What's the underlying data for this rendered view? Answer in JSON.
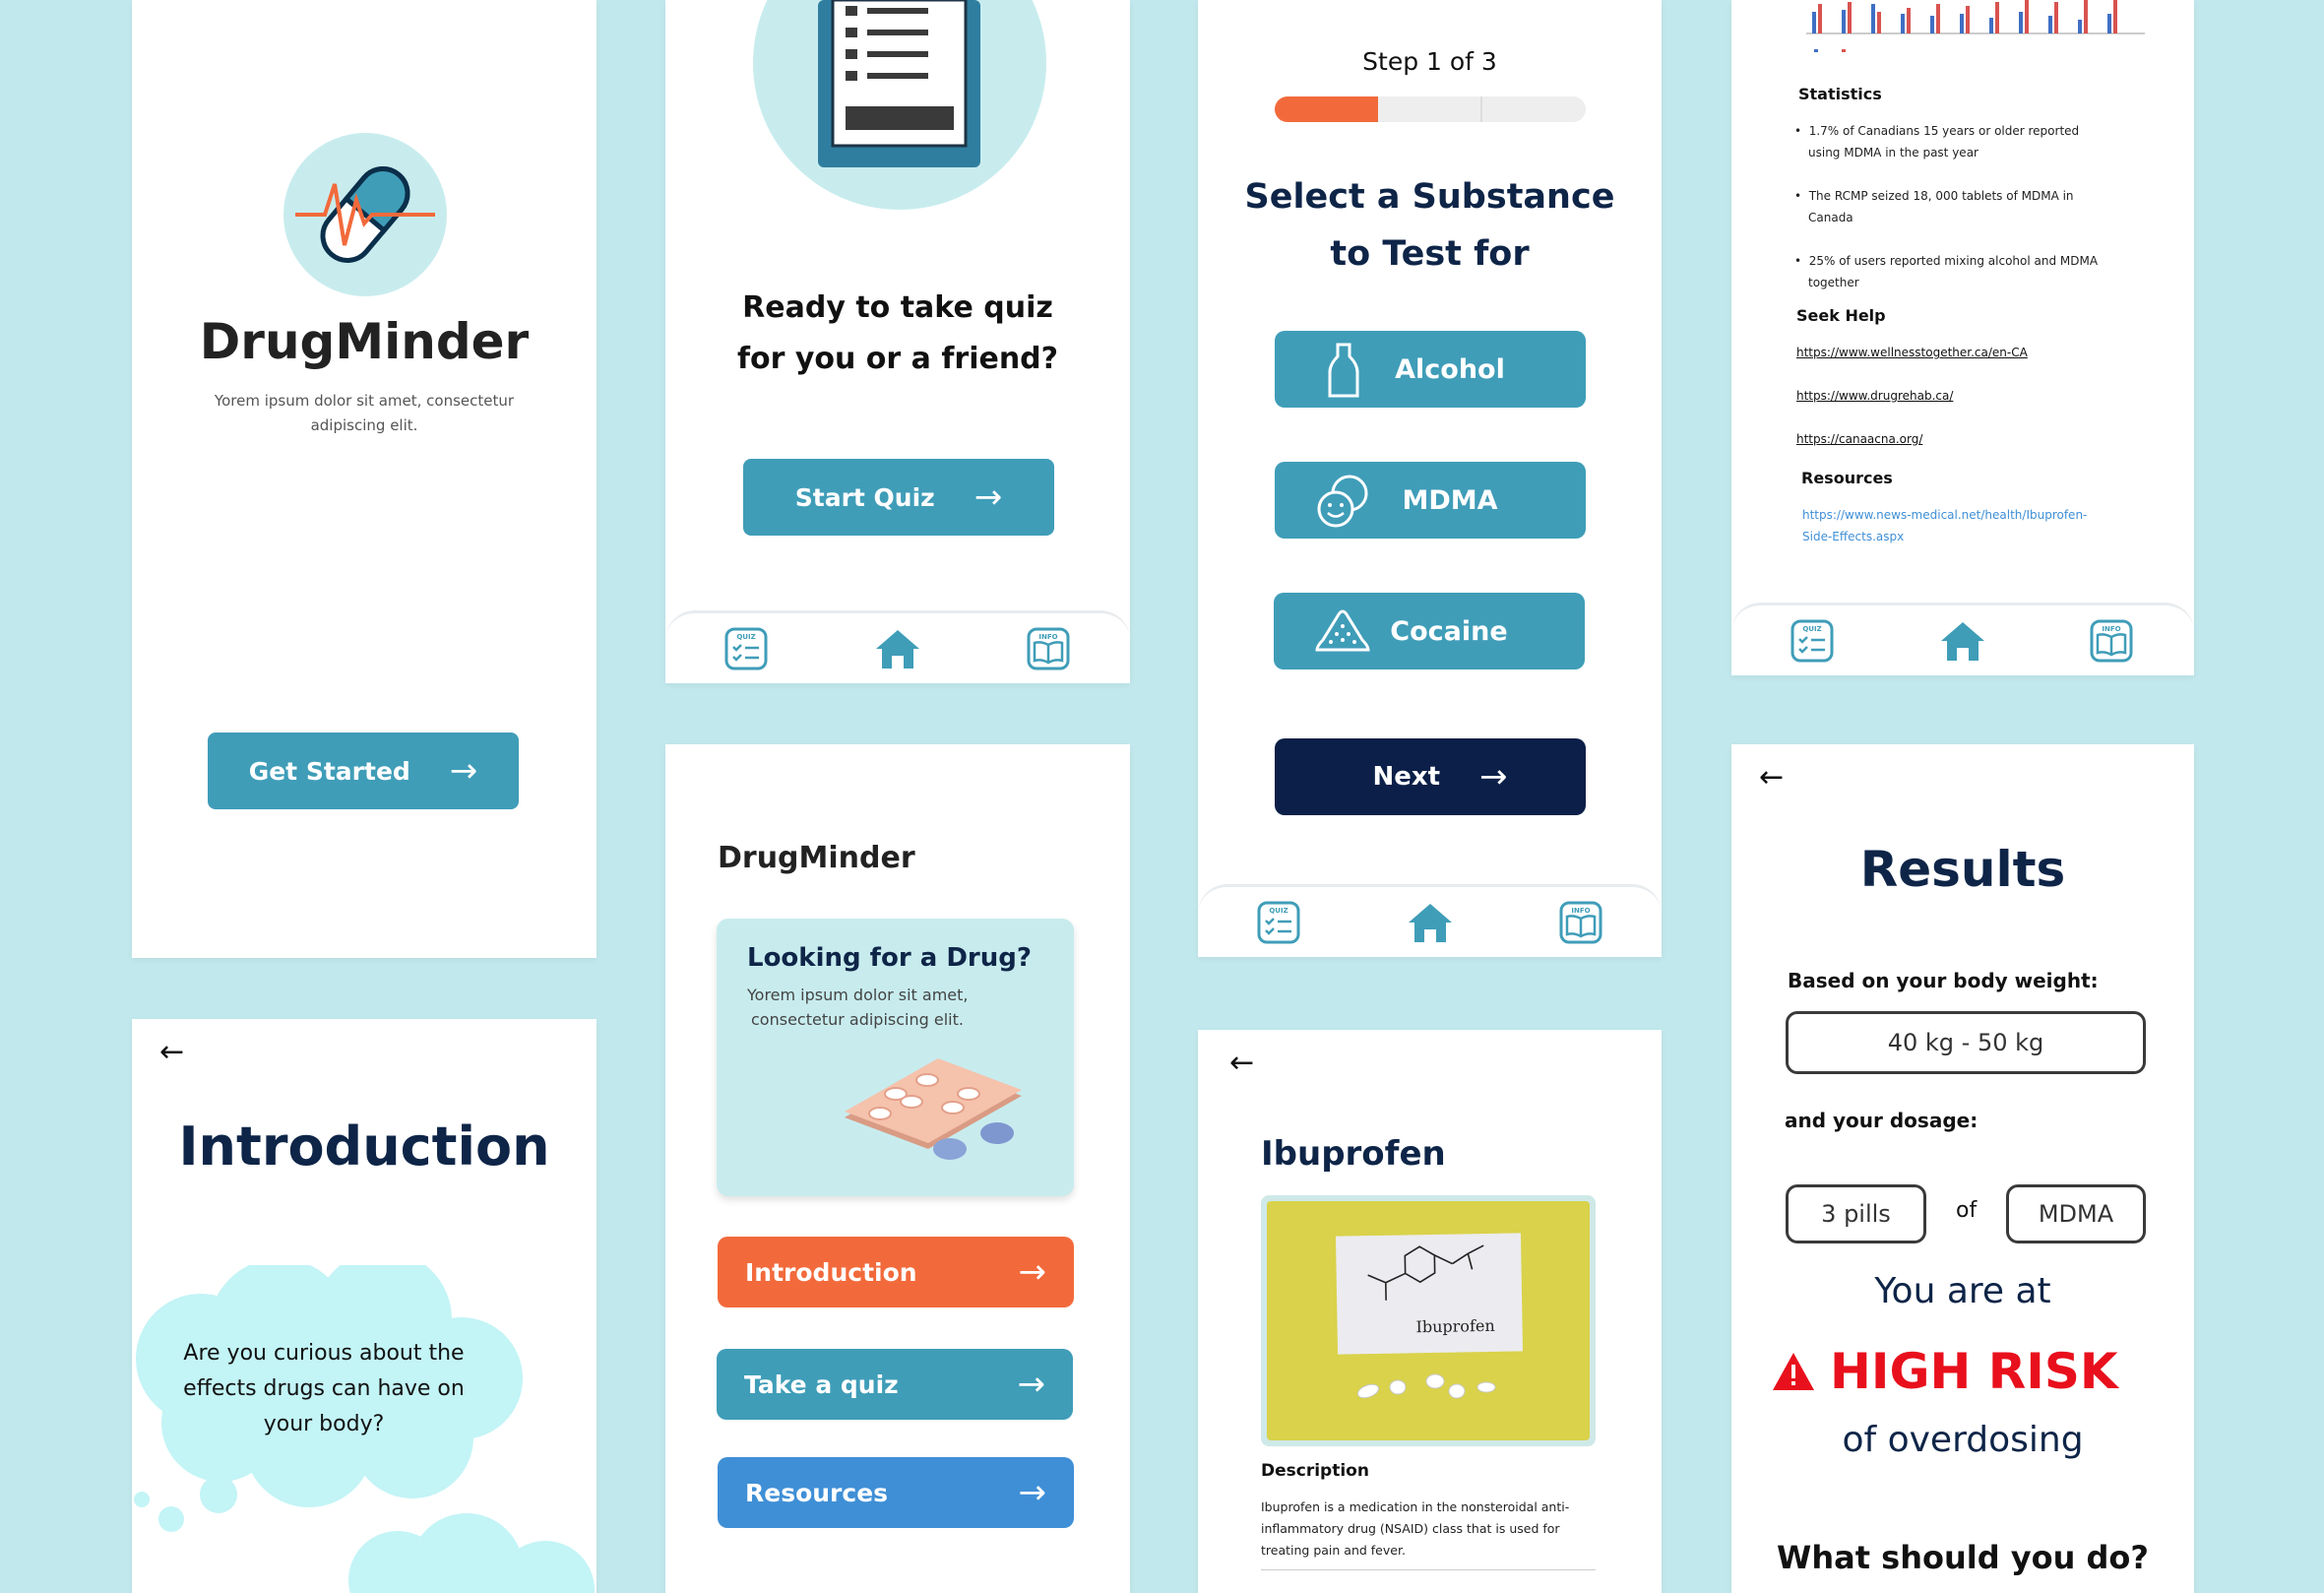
{
  "colors": {
    "background": "#c1e8ec",
    "teal": "#3f9db8",
    "navy": "#0b1f48",
    "orange": "#f26a3b",
    "blue": "#3f8fd6",
    "risk_red": "#e8101c",
    "light_teal": "#c8ecee"
  },
  "welcome": {
    "app_name": "DrugMinder",
    "tagline_line1": "Yorem ipsum dolor sit amet, consectetur",
    "tagline_line2": "adipiscing elit.",
    "get_started": "Get Started"
  },
  "intro": {
    "title": "Introduction",
    "question_line1": "Are you curious about the",
    "question_line2": "effects drugs can have on",
    "question_line3": "your body?"
  },
  "quiz_start": {
    "prompt_line1": "Ready to take quiz",
    "prompt_line2": "for you or a  friend?",
    "start_button": "Start Quiz"
  },
  "tabbar": {
    "quiz_icon_text": "QUIZ",
    "info_icon_text": "INFO"
  },
  "home": {
    "app_name": "DrugMinder",
    "card_title": "Looking for a Drug?",
    "card_text_line1": "Yorem ipsum dolor sit amet,",
    "card_text_line2": "consectetur adipiscing elit.",
    "menu": [
      "Introduction",
      "Take a quiz",
      "Resources"
    ]
  },
  "select": {
    "step": "Step 1 of 3",
    "title_line1": "Select a Substance",
    "title_line2": "to Test for",
    "options": [
      "Alcohol",
      "MDMA",
      "Cocaine"
    ],
    "next": "Next",
    "progress": 0.333
  },
  "drug": {
    "title": "Ibuprofen",
    "image_label": "Ibuprofen",
    "description_heading": "Description",
    "description_line1": "Ibuprofen is a medication in the nonsteroidal anti-",
    "description_line2": "inflammatory drug (NSAID) class that is used for",
    "description_line3": "treating pain and fever."
  },
  "info": {
    "statistics_heading": "Statistics",
    "stats": [
      {
        "line1": "1.7% of Canadians 15 years or older reported",
        "line2": "using MDMA in the past year"
      },
      {
        "line1": "The RCMP seized 18, 000 tablets of MDMA in",
        "line2": "Canada"
      },
      {
        "line1": "25% of users reported mixing alcohol and MDMA",
        "line2": "together"
      }
    ],
    "help_heading": "Seek Help",
    "help_links": [
      "https://www.wellnesstogether.ca/en-CA",
      "https://www.drugrehab.ca/",
      "https://canaacna.org/"
    ],
    "resources_heading": "Resources",
    "resource_link_line1": "https://www.news-medical.net/health/Ibuprofen-",
    "resource_link_line2": "Side-Effects.aspx"
  },
  "results": {
    "title": "Results",
    "weight_label": "Based on your body weight:",
    "weight_value": "40 kg - 50 kg",
    "dosage_label": "and your dosage:",
    "pills_value": "3 pills",
    "of_text": "of",
    "substance_value": "MDMA",
    "at_text": "You are at",
    "risk_text": "HIGH RISK",
    "overdose_text": "of overdosing",
    "next_question": "What should you do?"
  }
}
